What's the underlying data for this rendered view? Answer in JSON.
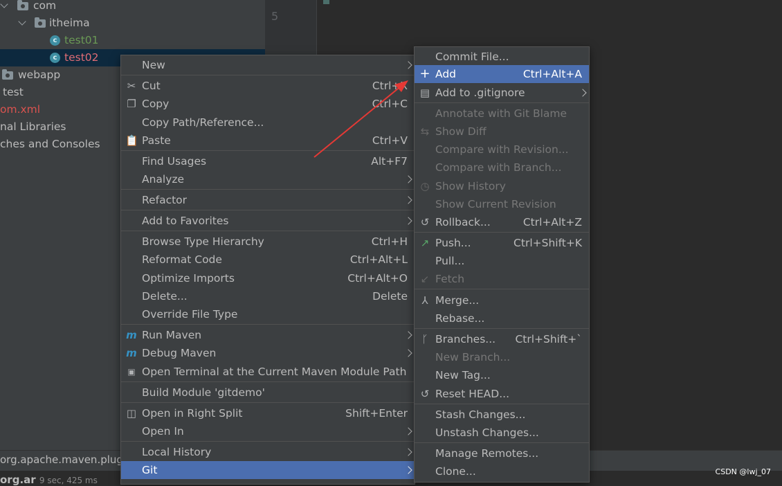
{
  "project_tree": {
    "rows": [
      {
        "label": "com"
      },
      {
        "label": "itheima"
      },
      {
        "label": "test01"
      },
      {
        "label": "test02"
      },
      {
        "label": "webapp"
      },
      {
        "label": "test"
      },
      {
        "label": "om.xml"
      },
      {
        "label": "nal Libraries"
      },
      {
        "label": "ches and Consoles"
      }
    ]
  },
  "editor": {
    "line_number": "5"
  },
  "context_menu": {
    "items": [
      {
        "label": "New",
        "shortcut": ""
      },
      {
        "label": "Cut",
        "shortcut": "Ctrl+X"
      },
      {
        "label": "Copy",
        "shortcut": "Ctrl+C"
      },
      {
        "label": "Copy Path/Reference...",
        "shortcut": ""
      },
      {
        "label": "Paste",
        "shortcut": "Ctrl+V"
      },
      {
        "label": "Find Usages",
        "shortcut": "Alt+F7"
      },
      {
        "label": "Analyze",
        "shortcut": ""
      },
      {
        "label": "Refactor",
        "shortcut": ""
      },
      {
        "label": "Add to Favorites",
        "shortcut": ""
      },
      {
        "label": "Browse Type Hierarchy",
        "shortcut": "Ctrl+H"
      },
      {
        "label": "Reformat Code",
        "shortcut": "Ctrl+Alt+L"
      },
      {
        "label": "Optimize Imports",
        "shortcut": "Ctrl+Alt+O"
      },
      {
        "label": "Delete...",
        "shortcut": "Delete"
      },
      {
        "label": "Override File Type",
        "shortcut": ""
      },
      {
        "label": "Run Maven",
        "shortcut": ""
      },
      {
        "label": "Debug Maven",
        "shortcut": ""
      },
      {
        "label": "Open Terminal at the Current Maven Module Path",
        "shortcut": ""
      },
      {
        "label": "Build Module 'gitdemo'",
        "shortcut": ""
      },
      {
        "label": "Open in Right Split",
        "shortcut": "Shift+Enter"
      },
      {
        "label": "Open In",
        "shortcut": ""
      },
      {
        "label": "Local History",
        "shortcut": ""
      },
      {
        "label": "Git",
        "shortcut": ""
      }
    ]
  },
  "git_menu": {
    "items": [
      {
        "label": "Commit File...",
        "shortcut": ""
      },
      {
        "label": "Add",
        "shortcut": "Ctrl+Alt+A"
      },
      {
        "label": "Add to .gitignore",
        "shortcut": ""
      },
      {
        "label": "Annotate with Git Blame",
        "shortcut": ""
      },
      {
        "label": "Show Diff",
        "shortcut": ""
      },
      {
        "label": "Compare with Revision...",
        "shortcut": ""
      },
      {
        "label": "Compare with Branch...",
        "shortcut": ""
      },
      {
        "label": "Show History",
        "shortcut": ""
      },
      {
        "label": "Show Current Revision",
        "shortcut": ""
      },
      {
        "label": "Rollback...",
        "shortcut": "Ctrl+Alt+Z"
      },
      {
        "label": "Push...",
        "shortcut": "Ctrl+Shift+K"
      },
      {
        "label": "Pull...",
        "shortcut": ""
      },
      {
        "label": "Fetch",
        "shortcut": ""
      },
      {
        "label": "Merge...",
        "shortcut": ""
      },
      {
        "label": "Rebase...",
        "shortcut": ""
      },
      {
        "label": "Branches...",
        "shortcut": "Ctrl+Shift+`"
      },
      {
        "label": "New Branch...",
        "shortcut": ""
      },
      {
        "label": "New Tag...",
        "shortcut": ""
      },
      {
        "label": "Reset HEAD...",
        "shortcut": ""
      },
      {
        "label": "Stash Changes...",
        "shortcut": ""
      },
      {
        "label": "Unstash Changes...",
        "shortcut": ""
      },
      {
        "label": "Manage Remotes...",
        "shortcut": ""
      },
      {
        "label": "Clone...",
        "shortcut": ""
      }
    ]
  },
  "bottom": {
    "console_line": "org.apache.maven.plug",
    "run_label": "org.ar",
    "run_time": "9 sec, 425 ms"
  },
  "watermark": "CSDN @lwj_07",
  "colors": {
    "menu_bg": "#3c3f41",
    "highlight": "#4b6eaf",
    "arrow": "#e53935",
    "class_green": "#6a9955",
    "class_red": "#e06c75"
  }
}
